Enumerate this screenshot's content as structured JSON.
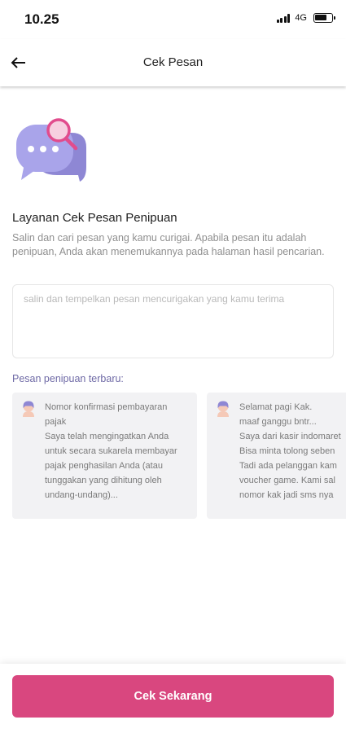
{
  "status_bar": {
    "time": "10.25",
    "network": "4G"
  },
  "app_bar": {
    "title": "Cek Pesan"
  },
  "service": {
    "title": "Layanan Cek Pesan Penipuan",
    "description": "Salin dan cari pesan yang kamu curigai. Apabila pesan itu adalah penipuan, Anda akan menemukannya pada halaman hasil pencarian."
  },
  "message_input": {
    "value": "",
    "placeholder": "salin dan tempelkan pesan mencurigakan yang kamu terima"
  },
  "recent": {
    "label": "Pesan penipuan terbaru:",
    "items": [
      {
        "title": "Nomor konfirmasi pembayaran pajak",
        "body": "Saya telah mengingatkan Anda untuk secara sukarela membayar pajak penghasilan Anda (atau tunggakan yang dihitung oleh undang-undang)..."
      },
      {
        "title": "",
        "body": "Selamat pagi Kak.\nmaaf ganggu bntr...\nSaya dari kasir indomaret\nBisa minta tolong seben\nTadi ada pelanggan kam\nvoucher game. Kami sal\nnomor kak jadi sms nya"
      }
    ]
  },
  "cta": {
    "label": "Cek Sekarang"
  },
  "colors": {
    "accent": "#d9477f",
    "label_purple": "#6f6aa6",
    "card_bg": "#f2f2f4"
  }
}
